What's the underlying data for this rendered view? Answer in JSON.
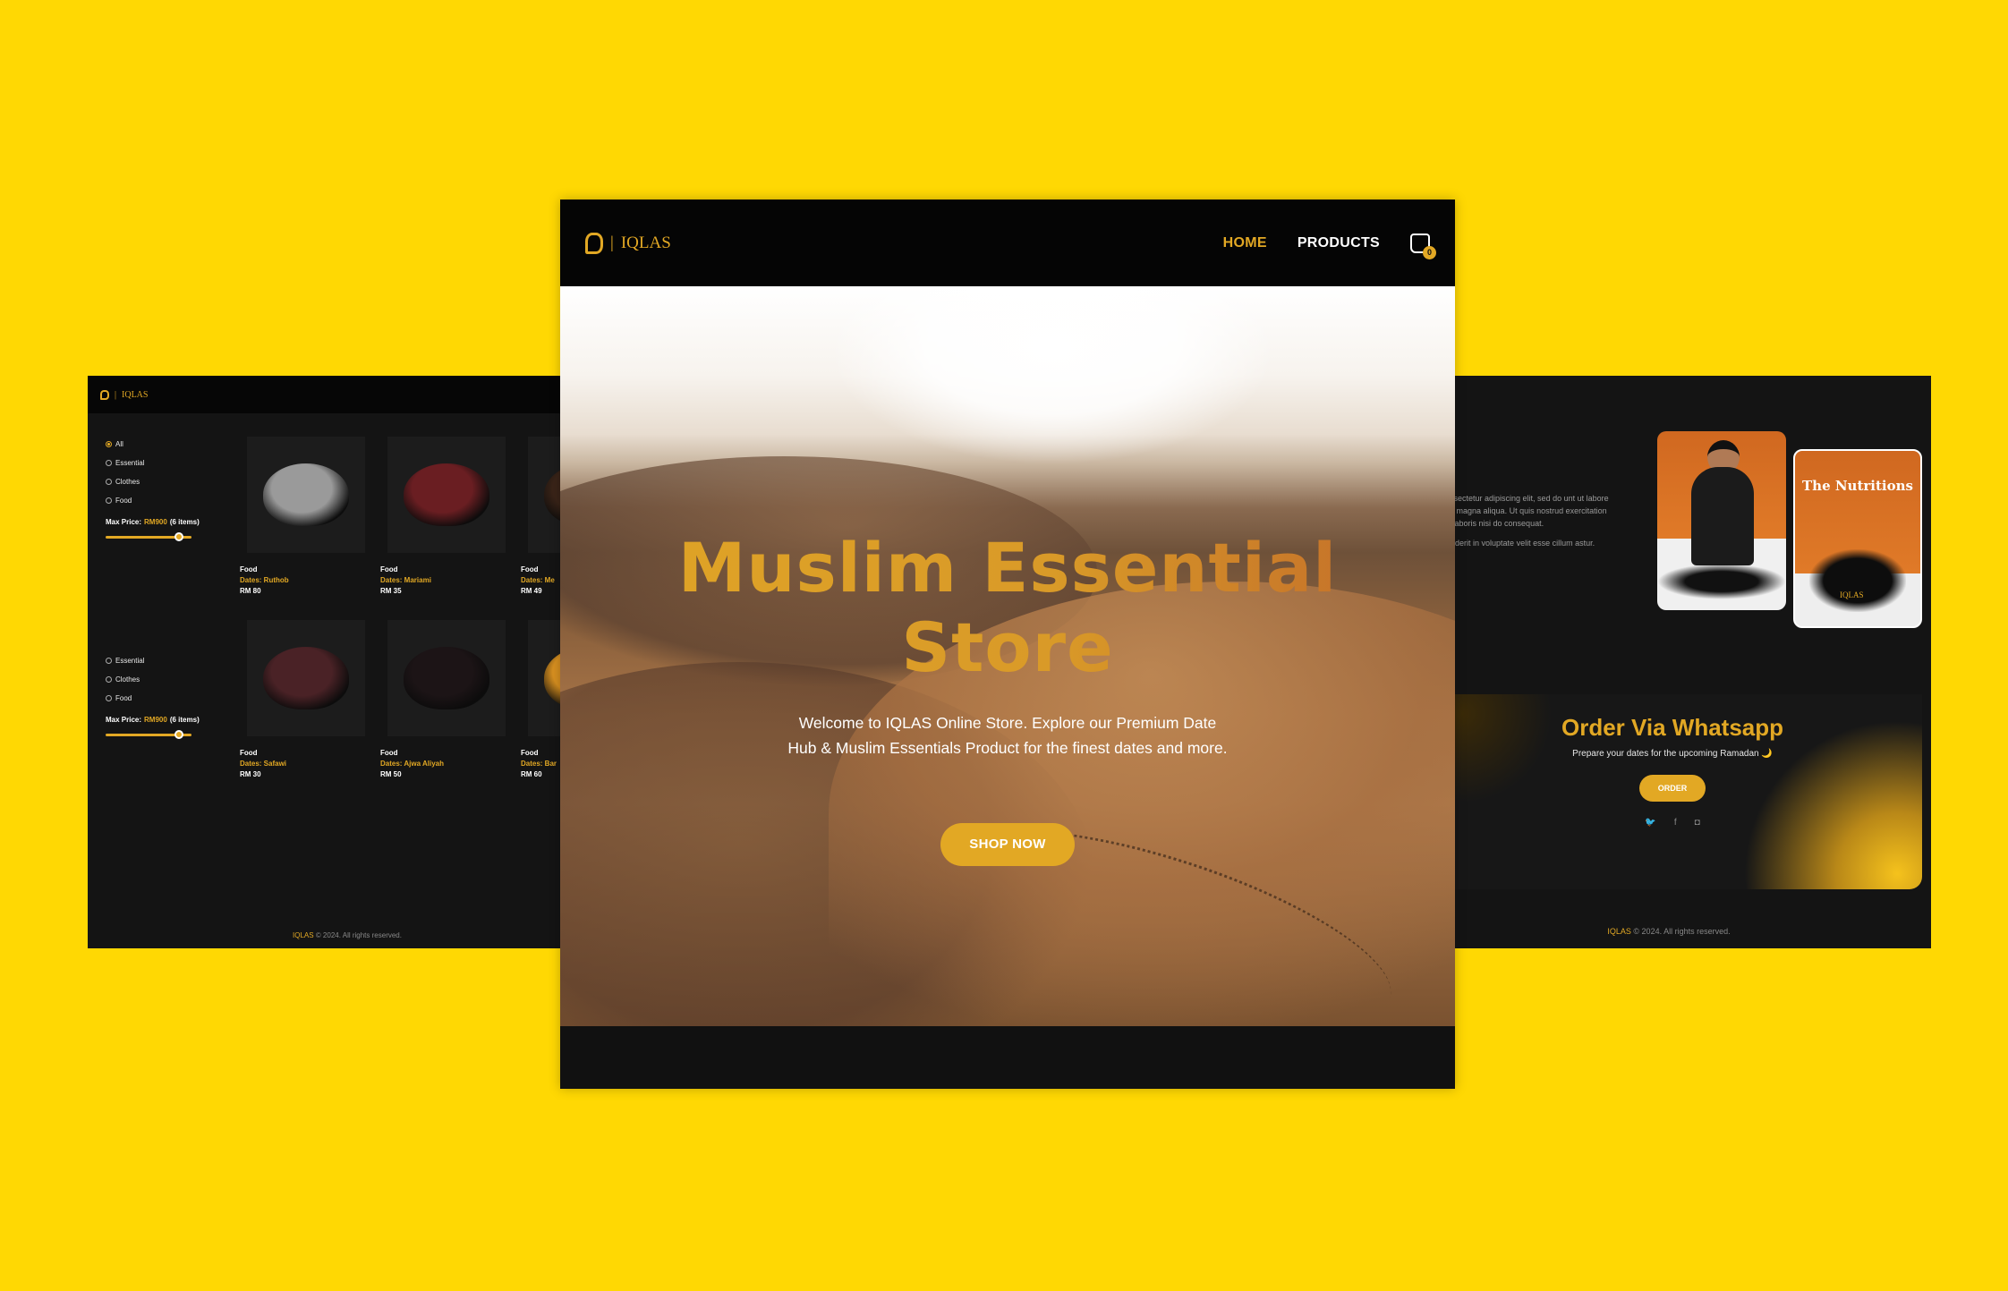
{
  "colors": {
    "background": "#FFD803",
    "accent": "#E2A824",
    "panel": "#141414"
  },
  "brand": {
    "name": "IQLAS",
    "separator": "|"
  },
  "center": {
    "nav": {
      "home": "HOME",
      "products": "PRODUCTS",
      "cart_icon": "shopping-bag-icon",
      "cart_count": "0"
    },
    "hero": {
      "title": "Muslim Essential Store",
      "subtitle": "Welcome to IQLAS Online Store. Explore our Premium Date Hub & Muslim Essentials Product for the finest dates and more.",
      "button": "SHOP NOW"
    }
  },
  "left": {
    "filters_top": [
      "All",
      "Essential",
      "Clothes",
      "Food"
    ],
    "filters_bottom": [
      "Essential",
      "Clothes",
      "Food"
    ],
    "price": {
      "label": "Max Price:",
      "value": "RM900",
      "count": "(6 items)",
      "level": 0.85
    },
    "products": [
      {
        "category": "Food",
        "name": "Dates: Ruthob",
        "price": "RM 80",
        "color": "#9a9a9a"
      },
      {
        "category": "Food",
        "name": "Dates: Mariami",
        "price": "RM 35",
        "color": "#6a1e22"
      },
      {
        "category": "Food",
        "name": "Dates: Me",
        "price": "RM 49",
        "color": "#3a2418"
      },
      {
        "category": "Food",
        "name": "Dates: Safawi",
        "price": "RM 30",
        "color": "#4a2226"
      },
      {
        "category": "Food",
        "name": "Dates: Ajwa Aliyah",
        "price": "RM 50",
        "color": "#1c1416"
      },
      {
        "category": "Food",
        "name": "Dates: Bar",
        "price": "RM 60",
        "color": "#d89020"
      }
    ],
    "footer": "© 2024. All rights reserved."
  },
  "right": {
    "about": [
      "met, consectetur adipiscing elit, sed do unt ut labore et dolore magna aliqua. Ut quis nostrud exercitation ullamco laboris nisi do consequat.",
      "reprehenderit in voluptate velit esse cillum astur."
    ],
    "nutrition_title": "The Nutritions",
    "order": {
      "title": "Order Via Whatsapp",
      "subtitle": "Prepare your dates for the upcoming Ramadan 🌙",
      "button": "ORDER",
      "socials": [
        "twitter-icon",
        "facebook-icon",
        "instagram-icon"
      ]
    },
    "footer": "© 2024. All rights reserved."
  }
}
